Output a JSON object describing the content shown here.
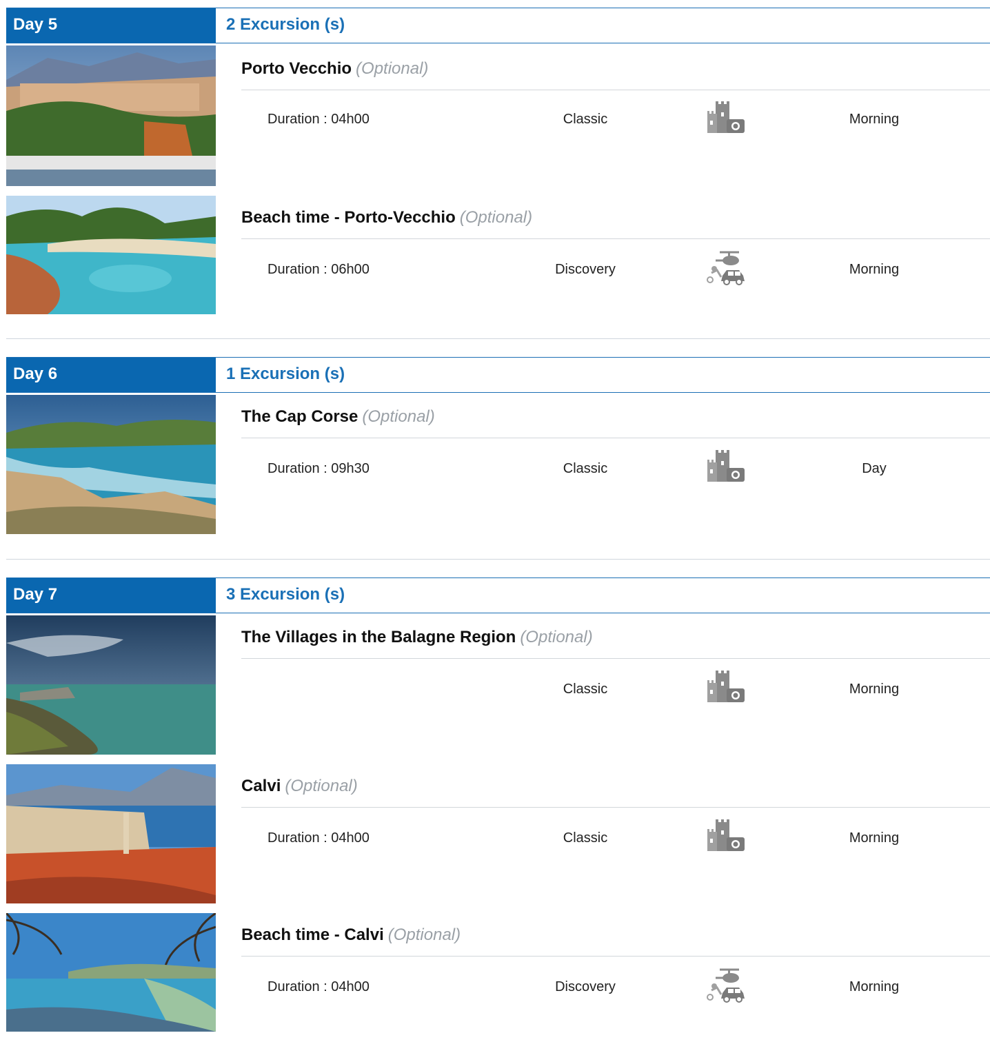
{
  "days": [
    {
      "label": "Day 5",
      "count": "2 Excursion (s)",
      "excursions": [
        {
          "title": "Porto Vecchio",
          "optional": "(Optional)",
          "duration": "Duration : 04h00",
          "type": "Classic",
          "icon": "castle-camera-icon",
          "time": "Morning"
        },
        {
          "title": "Beach time - Porto-Vecchio",
          "optional": "(Optional)",
          "duration": "Duration : 06h00",
          "type": "Discovery",
          "icon": "helicopter-car-icon",
          "time": "Morning"
        }
      ]
    },
    {
      "label": "Day 6",
      "count": "1 Excursion (s)",
      "excursions": [
        {
          "title": "The Cap Corse",
          "optional": "(Optional)",
          "duration": "Duration : 09h30",
          "type": "Classic",
          "icon": "castle-camera-icon",
          "time": "Day"
        }
      ]
    },
    {
      "label": "Day 7",
      "count": "3 Excursion (s)",
      "excursions": [
        {
          "title": "The Villages in the Balagne Region",
          "optional": "(Optional)",
          "duration": "",
          "type": "Classic",
          "icon": "castle-camera-icon",
          "time": "Morning"
        },
        {
          "title": "Calvi",
          "optional": "(Optional)",
          "duration": "Duration : 04h00",
          "type": "Classic",
          "icon": "castle-camera-icon",
          "time": "Morning"
        },
        {
          "title": "Beach time - Calvi",
          "optional": "(Optional)",
          "duration": "Duration : 04h00",
          "type": "Discovery",
          "icon": "helicopter-car-icon",
          "time": "Morning"
        }
      ]
    }
  ],
  "colors": {
    "accent": "#0a67b0",
    "accent_text": "#1a70b6",
    "optional": "#9aa0a6"
  }
}
